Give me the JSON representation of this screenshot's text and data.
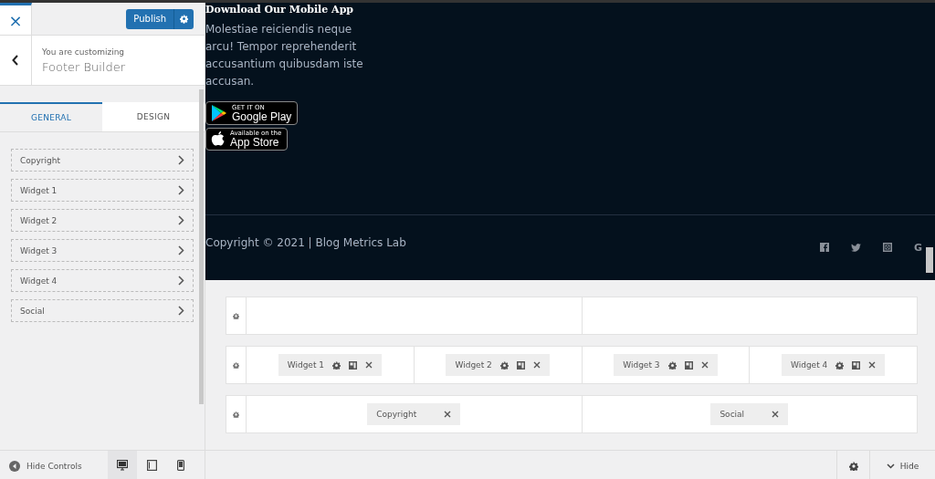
{
  "sidebar": {
    "close": "×",
    "publish": "Publish",
    "customizing_label": "You are customizing",
    "customizing_title": "Footer Builder",
    "tabs": [
      {
        "label": "GENERAL",
        "selected": true
      },
      {
        "label": "DESIGN",
        "selected": false
      }
    ],
    "items": [
      "Copyright",
      "Widget 1",
      "Widget 2",
      "Widget 3",
      "Widget 4",
      "Social"
    ]
  },
  "preview": {
    "heading": "Download Our Mobile App",
    "text": "Molestiae reiciendis neque arcu! Tempor reprehenderit accusantium quibusdam iste accusan.",
    "badges": [
      {
        "kind": "google",
        "small": "GET IT ON",
        "big": "Google Play"
      },
      {
        "kind": "apple",
        "small": "Available on the",
        "big": "App Store"
      }
    ],
    "copyright": "Copyright © 2021 | Blog Metrics Lab",
    "social_letter": "G"
  },
  "builder": {
    "rows": [
      {
        "columns": [
          [],
          []
        ]
      },
      {
        "columns": [
          [
            {
              "label": "Widget 1",
              "kind": "widget"
            }
          ],
          [
            {
              "label": "Widget 2",
              "kind": "widget"
            }
          ],
          [
            {
              "label": "Widget 3",
              "kind": "widget"
            }
          ],
          [
            {
              "label": "Widget 4",
              "kind": "widget"
            }
          ]
        ]
      },
      {
        "columns": [
          [
            {
              "label": "Copyright",
              "kind": "simple"
            }
          ],
          [
            {
              "label": "Social",
              "kind": "simple"
            }
          ]
        ]
      }
    ]
  },
  "footer": {
    "hide_controls": "Hide Controls",
    "devices": [
      {
        "kind": "desktop",
        "selected": true
      },
      {
        "kind": "tablet",
        "selected": false
      },
      {
        "kind": "mobile",
        "selected": false
      }
    ],
    "hide": "Hide"
  }
}
